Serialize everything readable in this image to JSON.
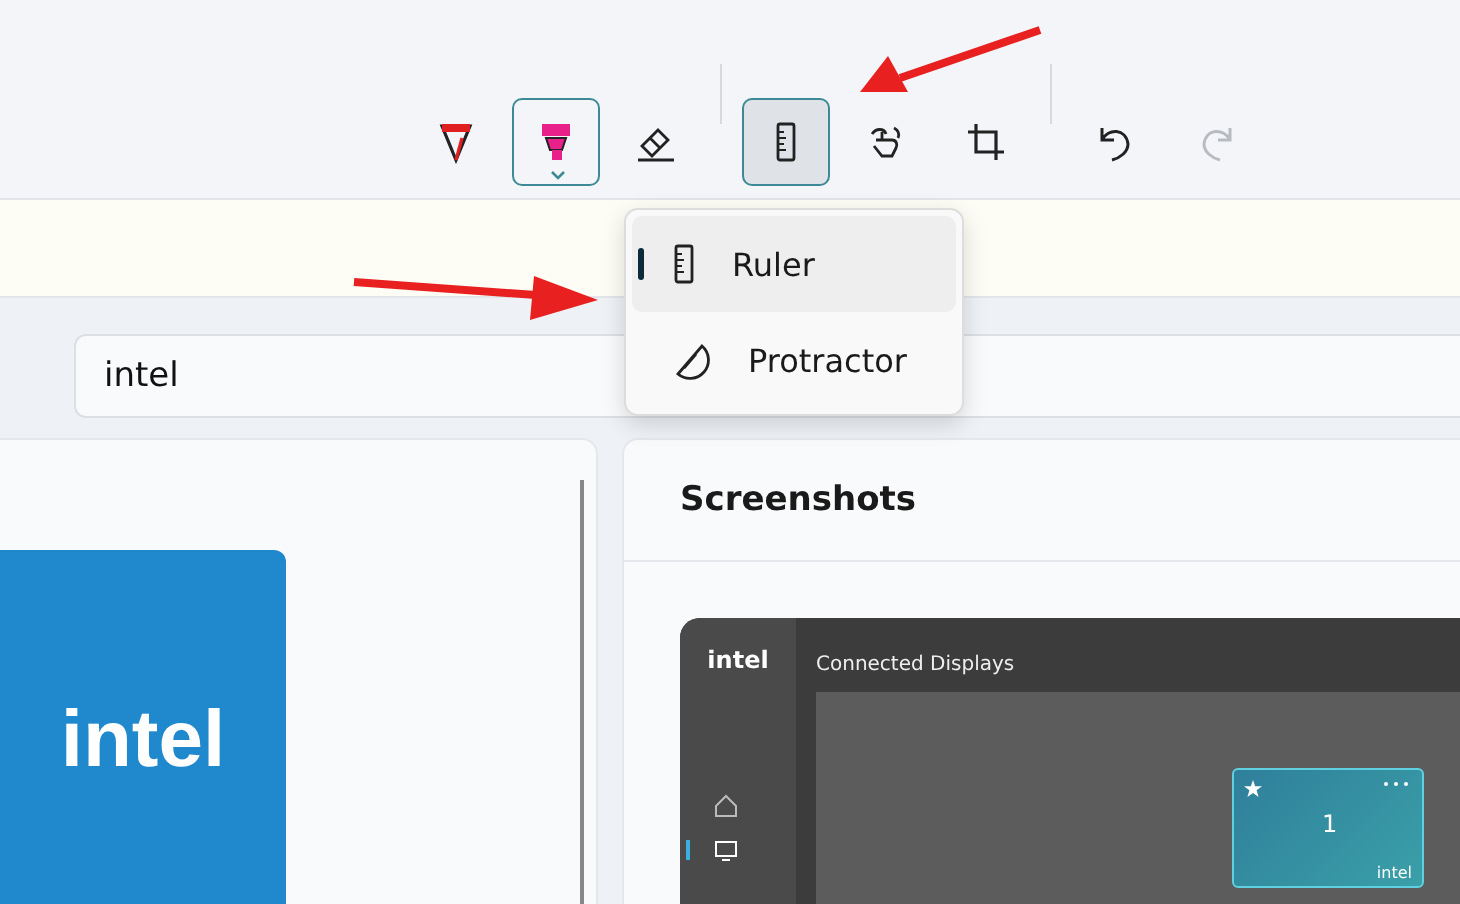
{
  "toolbar": {
    "tools": [
      {
        "kind": "pen",
        "selected": false,
        "expanded": false,
        "disabled": false
      },
      {
        "kind": "highlighter",
        "selected": true,
        "expanded": false,
        "disabled": false
      },
      {
        "kind": "eraser",
        "selected": false,
        "expanded": false,
        "disabled": false
      },
      {
        "kind": "separator"
      },
      {
        "kind": "ruler",
        "selected": false,
        "expanded": true,
        "disabled": false
      },
      {
        "kind": "touch",
        "selected": false,
        "expanded": false,
        "disabled": false
      },
      {
        "kind": "crop",
        "selected": false,
        "expanded": false,
        "disabled": false
      },
      {
        "kind": "separator"
      },
      {
        "kind": "undo",
        "selected": false,
        "expanded": false,
        "disabled": false
      },
      {
        "kind": "redo",
        "selected": false,
        "expanded": false,
        "disabled": true
      }
    ]
  },
  "ruler_menu": {
    "items": [
      {
        "kind": "ruler",
        "label": "Ruler",
        "selected": true
      },
      {
        "kind": "protractor",
        "label": "Protractor",
        "selected": false
      }
    ]
  },
  "search": {
    "value": "intel"
  },
  "app_logo": {
    "text": "intel"
  },
  "screenshots": {
    "title": "Screenshots",
    "screenshot": {
      "logo": "intel",
      "title": "Connected Displays",
      "nav": [
        {
          "kind": "home",
          "selected": false
        },
        {
          "kind": "display",
          "selected": true
        }
      ],
      "display_tile": {
        "number": "1",
        "brand": "intel",
        "starred": true
      }
    }
  }
}
